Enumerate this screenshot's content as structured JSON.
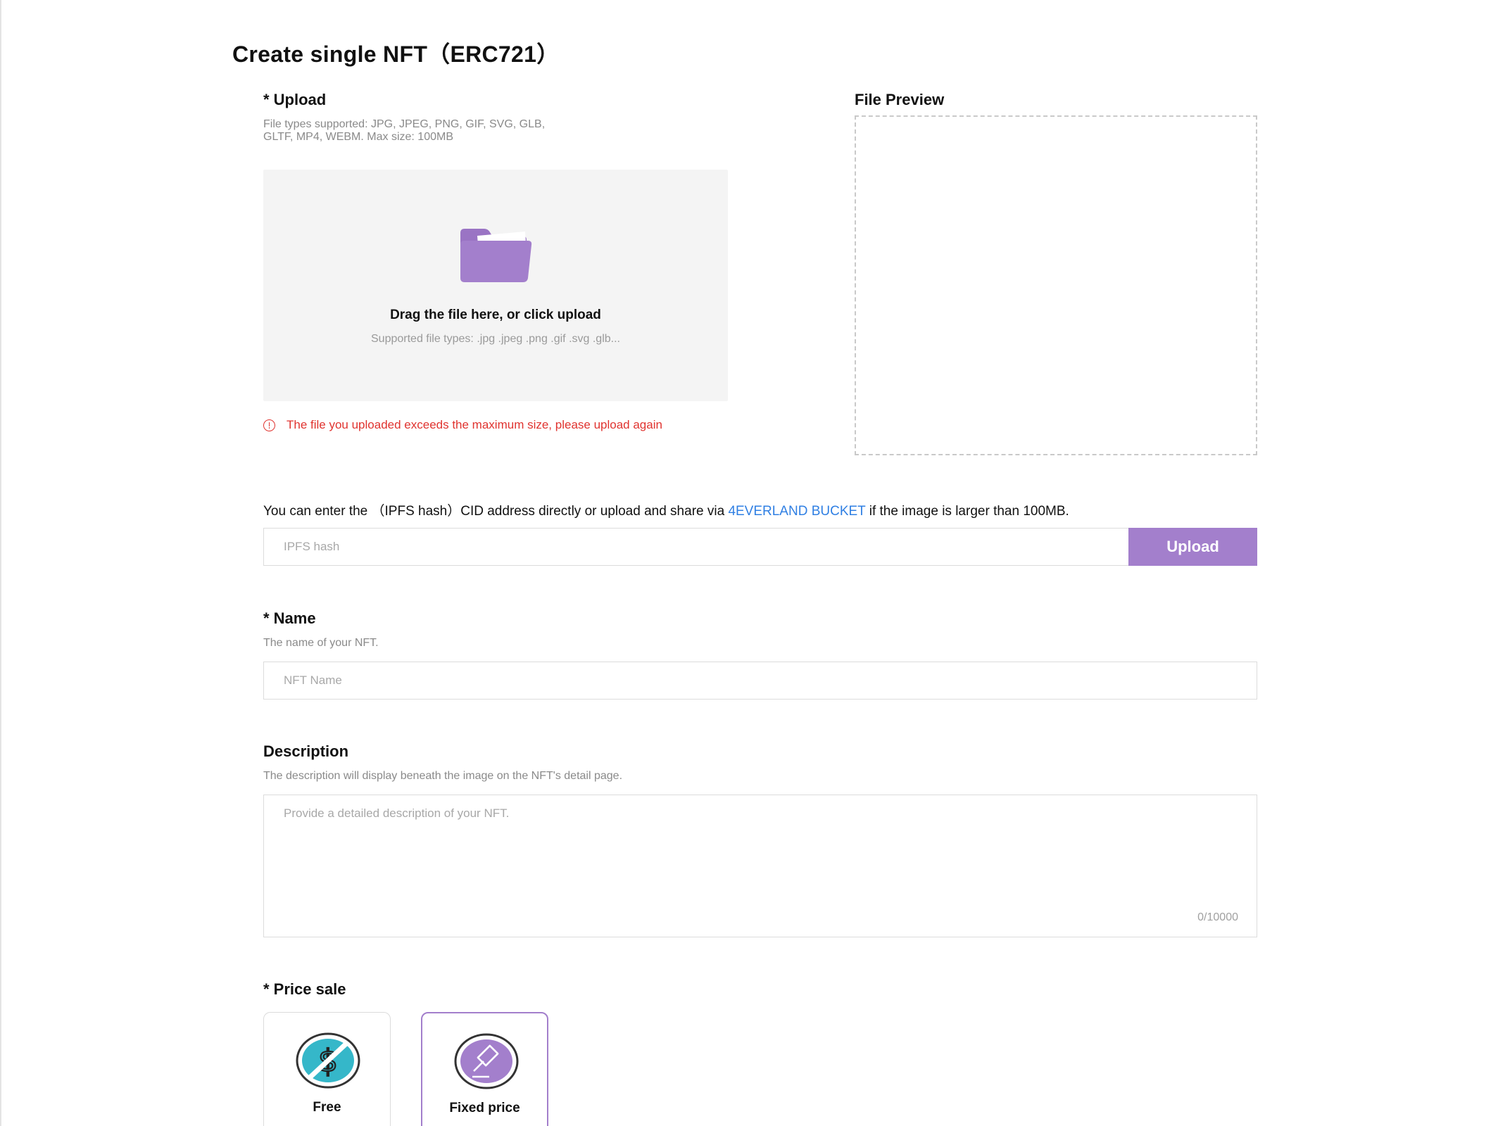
{
  "page": {
    "title": "Create single NFT（ERC721）"
  },
  "upload": {
    "label": "* Upload",
    "hint_line1": "File types supported: JPG, JPEG, PNG, GIF, SVG, GLB,",
    "hint_line2": "GLTF, MP4, WEBM. Max size: 100MB",
    "drop_title": "Drag the file here, or click upload",
    "drop_subtitle": "Supported file types: .jpg .jpeg .png .gif .svg .glb...",
    "error": "The file you uploaded exceeds the maximum size, please upload again",
    "icon": "folder-icon"
  },
  "preview": {
    "label": "File Preview"
  },
  "ipfs": {
    "text_before": "You can enter the （IPFS hash）CID address directly or upload and share via ",
    "link_text": "4EVERLAND BUCKET",
    "text_after": " if the image is larger than 100MB.",
    "placeholder": "IPFS hash",
    "value": "",
    "button_label": "Upload"
  },
  "name": {
    "label": "* Name",
    "hint": "The name of your NFT.",
    "placeholder": "NFT Name",
    "value": ""
  },
  "description": {
    "label": "Description",
    "hint": "The description will display beneath the image on the NFT's detail page.",
    "placeholder": "Provide a detailed description of your NFT.",
    "value": "",
    "counter": "0/10000"
  },
  "price_sale": {
    "label": "* Price sale",
    "options": [
      {
        "label": "Free",
        "icon": "no-dollar-icon",
        "selected": false
      },
      {
        "label": "Fixed price",
        "icon": "auction-hammer-icon",
        "selected": true
      }
    ]
  },
  "colors": {
    "accent": "#a37fcc",
    "link": "#2f7fe3",
    "error": "#e0332f",
    "free_icon": "#35b7c9"
  }
}
